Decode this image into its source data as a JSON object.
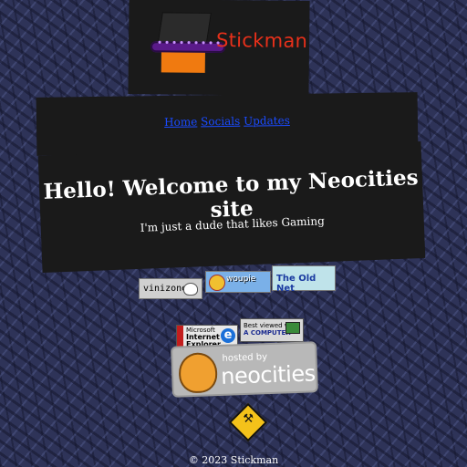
{
  "logo": {
    "text": "Stickman",
    "icon": "top-hat-box-icon"
  },
  "nav": {
    "links": [
      "Home",
      "Socials",
      "Updates"
    ]
  },
  "hero": {
    "title": "Hello! Welcome to my Neocities site",
    "subtitle": "I'm just a dude that likes Gaming"
  },
  "buttons": {
    "vinizone": "vinizone",
    "woupie": "woupie",
    "oldnet": "The Old Net",
    "ie_line1": "Microsoft",
    "ie_line2": "Internet",
    "ie_line3": "Explorer",
    "computer_line1": "Best viewed with",
    "computer_line2": "A COMPUTER"
  },
  "neocities": {
    "hosted": "hosted by",
    "name": "neocities"
  },
  "footer": {
    "text": "© 2023 Stickman"
  },
  "colors": {
    "panel": "#1a1a1a",
    "link": "#1a4bff",
    "logo_text": "#e8301a",
    "box": "#f07a10",
    "hat_brim": "#5a1a8a"
  }
}
